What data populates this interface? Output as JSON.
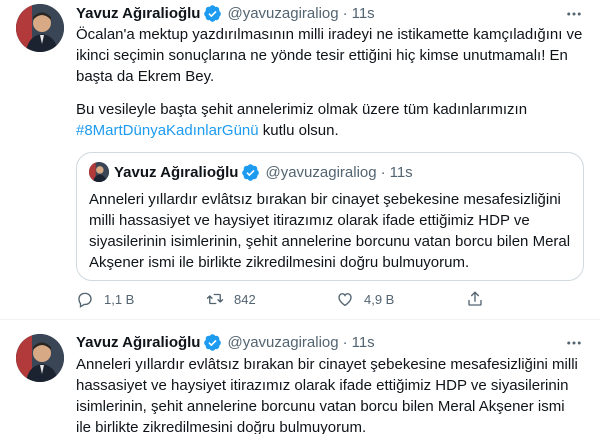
{
  "tweets": [
    {
      "author": {
        "name": "Yavuz Ağıralioğlu",
        "handle": "@yavuzagiraliog",
        "time": "11s",
        "dot": "·"
      },
      "paragraph1": [
        "Öcalan'a mektup yazdırılmasının milli iradeyi ne istikamette kamçıladığını ve",
        "ikinci seçimin sonuçlarına ne yönde tesir ettiğini hiç kimse unutmamalı! En",
        "başta da Ekrem Bey."
      ],
      "paragraph2": {
        "line1": "Bu vesileyle başta şehit annelerimiz olmak üzere tüm kadınlarımızın",
        "hashtag": "#8MartDünyaKadınlarGünü",
        "line2_rest": " kutlu olsun."
      },
      "quote": {
        "author": {
          "name": "Yavuz Ağıralioğlu",
          "handle": "@yavuzagiraliog",
          "time": "11s",
          "dot": "·"
        },
        "lines": [
          "Anneleri yıllardır evlâtsız bırakan bir cinayet şebekesine mesafesizliğini",
          "milli hassasiyet ve haysiyet itirazımız olarak ifade ettiğimiz HDP ve",
          "siyasilerinin isimlerinin, şehit annelerine borcunu vatan borcu bilen Meral",
          "Akşener ismi ile birlikte zikredilmesini doğru bulmuyorum."
        ]
      },
      "actions": {
        "replies": "1,1 B",
        "retweets": "842",
        "likes": "4,9 B"
      }
    },
    {
      "author": {
        "name": "Yavuz Ağıralioğlu",
        "handle": "@yavuzagiraliog",
        "time": "11s",
        "dot": "·"
      },
      "lines": [
        "Anneleri yıllardır evlâtsız bırakan bir cinayet şebekesine mesafesizliğini milli",
        "hassasiyet ve haysiyet itirazımız olarak ifade ettiğimiz HDP ve siyasilerinin",
        "isimlerinin, şehit annelerine borcunu vatan borcu bilen Meral Akşener ismi",
        "ile birlikte zikredilmesini doğru bulmuyorum."
      ]
    }
  ],
  "icons": {
    "verified": "verified-badge-icon",
    "more": "more-options-icon",
    "reply": "reply-icon",
    "retweet": "retweet-icon",
    "like": "heart-icon",
    "share": "share-icon"
  },
  "colors": {
    "accent": "#1d9bf0",
    "text": "#0f1419",
    "secondary": "#536471",
    "border": "#cfd9de",
    "divider": "#eff3f4"
  }
}
